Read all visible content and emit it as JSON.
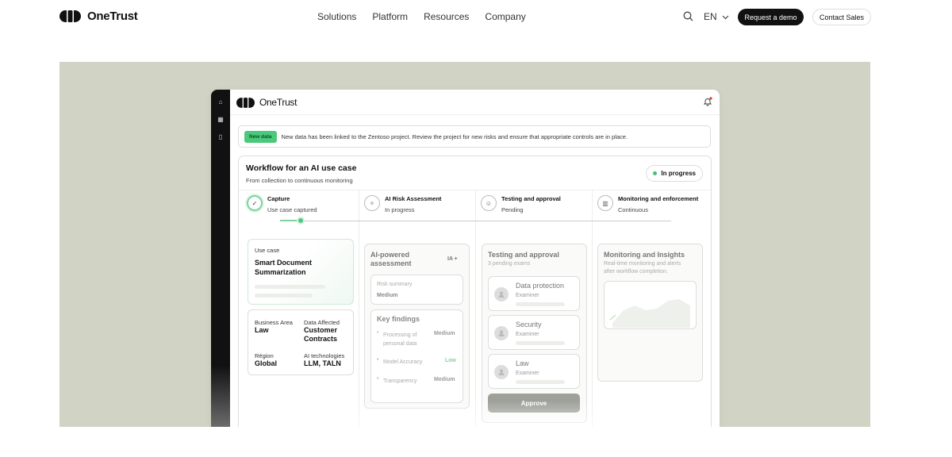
{
  "nav": {
    "brand": "OneTrust",
    "links": [
      "Solutions",
      "Platform",
      "Resources",
      "Company"
    ],
    "lang": "EN",
    "request_demo": "Request a demo",
    "contact_sales": "Contact Sales"
  },
  "app": {
    "brand": "OneTrust",
    "banner": {
      "tag": "New data",
      "text": "New data has been linked to the Zentoso project. Review the project for new risks and ensure that appropriate controls are in place."
    },
    "workflow": {
      "title": "Workflow for an AI use case",
      "subtitle": "From collection to continuous monitoring",
      "status": "In progress",
      "steps": [
        {
          "title": "Capture",
          "status": "Use case captured"
        },
        {
          "title": "AI Risk Assessment",
          "status": "In progress"
        },
        {
          "title": "Testing and approval",
          "status": "Pending"
        },
        {
          "title": "Monitoring and enforcement",
          "status": "Continuous"
        }
      ]
    },
    "usecase": {
      "label": "Use case",
      "name_line1": "Smart Document",
      "name_line2": "Summarization",
      "fields": {
        "business_area_label": "Business Area",
        "business_area": "Law",
        "data_affected_label": "Data Affected",
        "data_affected_line1": "Customer",
        "data_affected_line2": "Contracts",
        "region_label": "Région",
        "region": "Global",
        "ai_tech_label": "AI technologies",
        "ai_tech": "LLM, TALN"
      }
    },
    "assessment": {
      "title_line1": "AI-powered",
      "title_line2": "assessment",
      "badge": "IA +",
      "risk_label": "Risk summary",
      "risk_value": "Medium",
      "findings_title": "Key findings",
      "findings": [
        {
          "line1": "Processing of",
          "line2": "personal data",
          "level": "Medium"
        },
        {
          "line1": "Model Accuracy",
          "line2": "",
          "level": "Low"
        },
        {
          "line1": "Transparency",
          "line2": "",
          "level": "Medium"
        }
      ]
    },
    "testing": {
      "title": "Testing and approval",
      "subtitle": "3 pending exams",
      "exams": [
        {
          "name": "Data protection",
          "role": "Examiner"
        },
        {
          "name": "Security",
          "role": "Examiner"
        },
        {
          "name": "Law",
          "role": "Examiner"
        }
      ],
      "approve": "Approve"
    },
    "monitoring": {
      "title": "Monitoring and Insights",
      "subtitle_line1": "Real-time monitoring and alerts",
      "subtitle_line2": "after workflow completion."
    }
  },
  "colors": {
    "hero_bg": "#d1d3c4",
    "accent_green": "#4cc87a",
    "low_risk": "#5cc487"
  }
}
